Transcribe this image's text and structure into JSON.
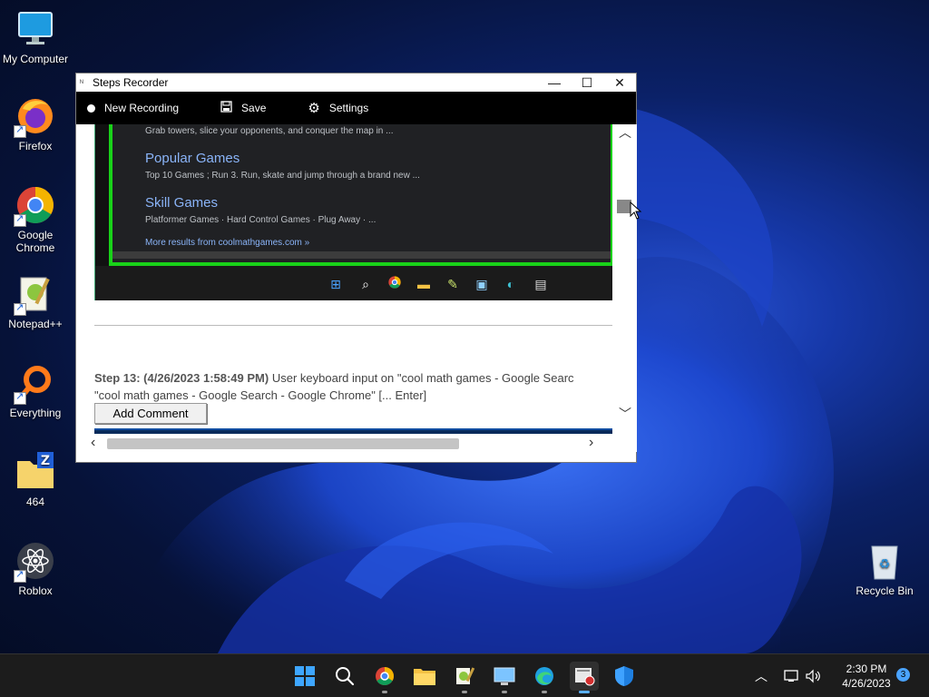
{
  "desktop": {
    "icons": [
      {
        "label": "My Computer"
      },
      {
        "label": "Firefox"
      },
      {
        "label": "Google Chrome"
      },
      {
        "label": "Notepad++"
      },
      {
        "label": "Everything"
      },
      {
        "label": "464"
      },
      {
        "label": "Roblox"
      },
      {
        "label": "Recycle Bin"
      }
    ]
  },
  "window": {
    "title": "Steps Recorder",
    "toolbar": {
      "new_recording": "New Recording",
      "save": "Save",
      "settings": "Settings"
    }
  },
  "screenshot": {
    "snippet_top": "Grab towers, slice your opponents, and conquer the map in ...",
    "results": [
      {
        "title": "Popular Games",
        "desc": "Top 10 Games ; Run 3. Run, skate and jump through a brand new ..."
      },
      {
        "title": "Skill Games",
        "desc": "Platformer Games · Hard Control Games · Plug Away · ..."
      }
    ],
    "more_results": "More results from coolmathgames.com »"
  },
  "step": {
    "label": "Step 13: (4/26/2023 1:58:49 PM)",
    "line1": "User keyboard input on \"cool math games - Google Searc",
    "line2": "\"cool math games - Google Search - Google Chrome\" [... Enter]",
    "add_comment": "Add Comment"
  },
  "taskbar": {
    "time": "2:30 PM",
    "date": "4/26/2023",
    "notification_count": "3"
  }
}
